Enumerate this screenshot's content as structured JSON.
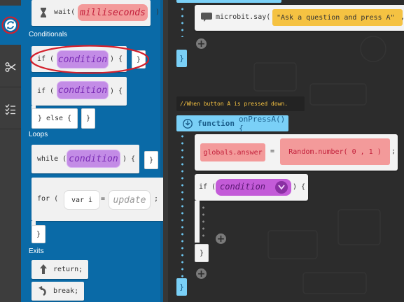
{
  "palette": {
    "wait_label": "wait(",
    "wait_param": "milliseconds",
    "wait_close": ")",
    "cat_conditionals": "Conditionals",
    "if_label": "if (",
    "condition": "condition",
    "cond_close": ") {",
    "brace_close": "}",
    "else_label": "} else {",
    "cat_loops": "Loops",
    "while_label": "while (",
    "for_label": "for (",
    "for_var": "var i",
    "eq": "=",
    "update": "update",
    "semicolon": ";",
    "cat_exits": "Exits",
    "return_label": "return;",
    "break_label": "break;"
  },
  "editor": {
    "say_call": "microbit.say(",
    "say_text": "\"Ask a question and press A\"",
    "say_close": ",",
    "comment": "//When button A is pressed down.",
    "function_keyword": "function",
    "function_name": "onPressA() {",
    "assign_target": "globals.answer",
    "assign_eq": "=",
    "random_call": "Random.number( 0 ,  1 )",
    "semicolon": ";",
    "if_label": "if (",
    "if_condition": "condition",
    "if_close": ") {",
    "brace_close": "}"
  },
  "colors": {
    "palette_bg": "#0a6aa7",
    "highlight_ring": "#d4202c",
    "condition_purple": "#c38ce6",
    "param_pink": "#f39a9a",
    "brace_blue": "#7ad0f7",
    "comment_yellow": "#f5c242"
  }
}
